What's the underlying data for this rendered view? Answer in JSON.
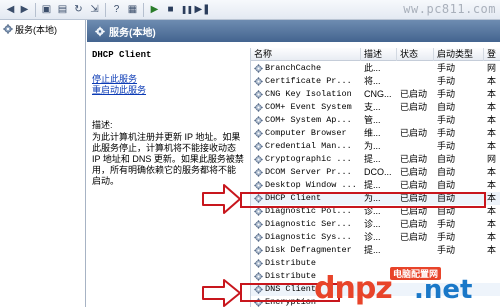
{
  "toolbar": {
    "buttons": [
      "back",
      "forward",
      "up",
      "show-hide-tree",
      "refresh",
      "export",
      "help",
      "console",
      "start",
      "stop",
      "pause",
      "restart"
    ],
    "watermark": "ww.pc811.com"
  },
  "tree": {
    "item_label": "服务(本地)"
  },
  "header": {
    "title": "服务(本地)"
  },
  "description": {
    "service_name": "DHCP Client",
    "stop_link": "停止此服务",
    "restart_link": "重启动此服务",
    "label": "描述:",
    "text": "为此计算机注册并更新 IP 地址。如果此服务停止，计算机将不能接收动态 IP 地址和 DNS 更新。如果此服务被禁用，所有明确依赖它的服务都将不能启动。"
  },
  "list": {
    "columns": {
      "name": "名称",
      "desc": "描述",
      "status": "状态",
      "startup": "启动类型",
      "logon": "登"
    },
    "rows": [
      {
        "name": "BranchCache",
        "desc": "此...",
        "status": "",
        "startup": "手动",
        "logon": "网"
      },
      {
        "name": "Certificate Pr...",
        "desc": "将...",
        "status": "",
        "startup": "手动",
        "logon": "本"
      },
      {
        "name": "CNG Key Isolation",
        "desc": "CNG...",
        "status": "已启动",
        "startup": "手动",
        "logon": "本"
      },
      {
        "name": "COM+ Event System",
        "desc": "支...",
        "status": "已启动",
        "startup": "自动",
        "logon": "本"
      },
      {
        "name": "COM+ System Ap...",
        "desc": "管...",
        "status": "",
        "startup": "手动",
        "logon": "本"
      },
      {
        "name": "Computer Browser",
        "desc": "维...",
        "status": "已启动",
        "startup": "手动",
        "logon": "本"
      },
      {
        "name": "Credential Man...",
        "desc": "为...",
        "status": "",
        "startup": "手动",
        "logon": "本"
      },
      {
        "name": "Cryptographic ...",
        "desc": "提...",
        "status": "已启动",
        "startup": "自动",
        "logon": "网"
      },
      {
        "name": "DCOM Server Pr...",
        "desc": "DCO...",
        "status": "已启动",
        "startup": "自动",
        "logon": "本"
      },
      {
        "name": "Desktop Window ...",
        "desc": "提...",
        "status": "已启动",
        "startup": "自动",
        "logon": "本"
      },
      {
        "name": "DHCP Client",
        "desc": "为...",
        "status": "已启动",
        "startup": "自动",
        "logon": "本"
      },
      {
        "name": "Diagnostic Pol...",
        "desc": "诊...",
        "status": "已启动",
        "startup": "自动",
        "logon": "本"
      },
      {
        "name": "Diagnostic Ser...",
        "desc": "诊...",
        "status": "已启动",
        "startup": "手动",
        "logon": "本"
      },
      {
        "name": "Diagnostic Sys...",
        "desc": "诊...",
        "status": "已启动",
        "startup": "手动",
        "logon": "本"
      },
      {
        "name": "Disk Defragmenter",
        "desc": "提...",
        "status": "",
        "startup": "手动",
        "logon": "本"
      },
      {
        "name": "Distribute",
        "desc": "",
        "status": "",
        "startup": "",
        "logon": ""
      },
      {
        "name": "Distribute",
        "desc": "",
        "status": "",
        "startup": "",
        "logon": ""
      },
      {
        "name": "DNS Client",
        "desc": "",
        "status": "",
        "startup": "",
        "logon": ""
      },
      {
        "name": "Encryption",
        "desc": "",
        "status": "",
        "startup": "",
        "logon": ""
      }
    ]
  },
  "highlights": {
    "color": "#c8161d",
    "selected_rows": [
      "DHCP Client",
      "DNS Client"
    ]
  },
  "watermark": {
    "brand": "dnpz",
    "suffix": ".net",
    "cn_label": "电脑配置网",
    "brand_color": "#e8442a",
    "suffix_color": "#1a78c8"
  }
}
